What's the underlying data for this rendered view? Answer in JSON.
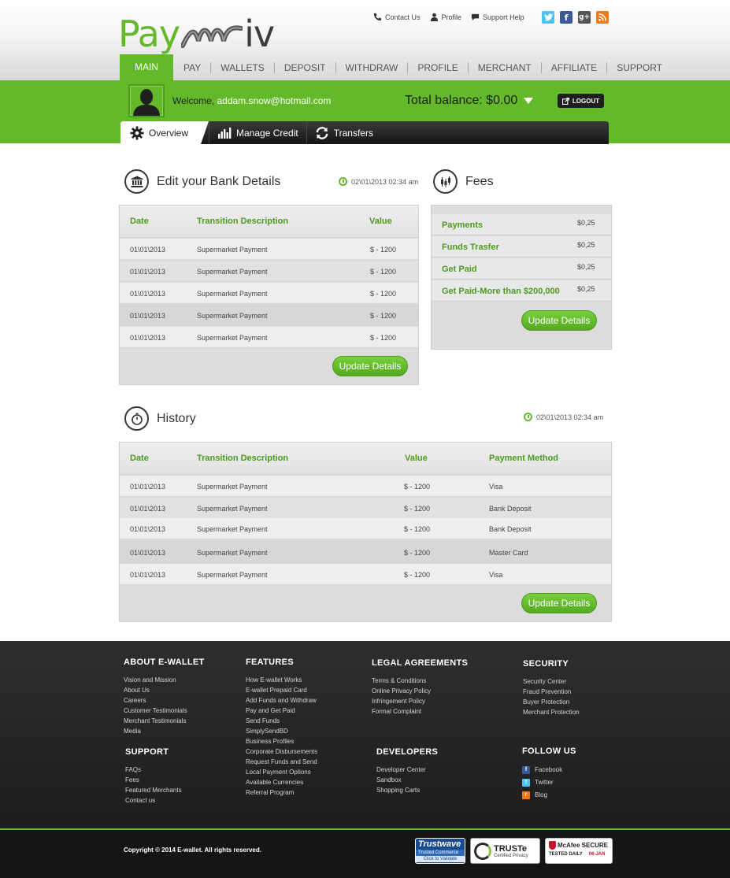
{
  "brand": {
    "logo_left": "Pay",
    "logo_right": "iv",
    "green": "#63b92a",
    "dark": "#1e1e1e"
  },
  "toplinks": [
    {
      "label": "Contact Us",
      "icon": "phone-icon"
    },
    {
      "label": "Profile",
      "icon": "user-icon"
    },
    {
      "label": "Support Help",
      "icon": "chat-bubble-icon"
    }
  ],
  "social_header": [
    {
      "name": "twitter",
      "glyph": "t",
      "color": "#4fc3ee"
    },
    {
      "name": "facebook",
      "glyph": "f",
      "color": "#3b5998"
    },
    {
      "name": "google-plus",
      "glyph": "g+",
      "color": "#555555"
    },
    {
      "name": "rss",
      "glyph": "r",
      "color": "#f07a1a"
    }
  ],
  "nav": [
    "MAIN",
    "PAY",
    "WALLETS",
    "DEPOSIT",
    "WITHDRAW",
    "PROFILE",
    "MERCHANT",
    "AFFILIATE",
    "SUPPORT"
  ],
  "user": {
    "welcome_label": "Welcome,",
    "email": "addam.snow@hotmail.com",
    "balance_label": "Total balance: $0.00",
    "logout_label": "LOGOUT"
  },
  "subtabs": [
    {
      "label": "Overview",
      "icon": "gear-icon"
    },
    {
      "label": "Manage Credit",
      "icon": "bar-chart-icon"
    },
    {
      "label": "Transfers",
      "icon": "refresh-icon"
    }
  ],
  "bank": {
    "title": "Edit your Bank Details",
    "timestamp": "02\\01\\2013 02:34 am",
    "headers": [
      "Date",
      "Transition Description",
      "Value"
    ],
    "rows": [
      [
        "01\\01\\2013",
        "Supermarket Payment",
        "$ - 1200"
      ],
      [
        "01\\01\\2013",
        "Supermarket Payment",
        "$ - 1200"
      ],
      [
        "01\\01\\2013",
        "Supermarket Payment",
        "$ - 1200"
      ],
      [
        "01\\01\\2013",
        "Supermarket Payment",
        "$ - 1200"
      ],
      [
        "01\\01\\2013",
        "Supermarket Payment",
        "$ - 1200"
      ]
    ],
    "button": "Update Details"
  },
  "fees": {
    "title": "Fees",
    "rows": [
      {
        "label": "Payments",
        "value": "$0,25"
      },
      {
        "label": "Funds Trasfer",
        "value": "$0,25"
      },
      {
        "label": "Get Paid",
        "value": "$0,25"
      },
      {
        "label": "Get Paid-More than $200,000",
        "value": "$0,25"
      }
    ],
    "button": "Update Details"
  },
  "history": {
    "title": "History",
    "timestamp": "02\\01\\2013 02:34 am",
    "headers": [
      "Date",
      "Transition Description",
      "Value",
      "Payment Method"
    ],
    "rows": [
      [
        "01\\01\\2013",
        "Supermarket Payment",
        "$ - 1200",
        "Visa"
      ],
      [
        "01\\01\\2013",
        "Supermarket Payment",
        "$ - 1200",
        "Bank Deposit"
      ],
      [
        "01\\01\\2013",
        "Supermarket Payment",
        "$ - 1200",
        "Bank Deposit"
      ],
      [
        "01\\01\\2013",
        "Supermarket Payment",
        "$ - 1200",
        "Master Card"
      ],
      [
        "01\\01\\2013",
        "Supermarket Payment",
        "$ - 1200",
        "Visa"
      ]
    ],
    "button": "Update Details"
  },
  "footer": {
    "about": {
      "title": "ABOUT E-WALLET",
      "links": [
        "Vision and Mission",
        "About Us",
        "Careers",
        "Customer Testimonials",
        "Merchant Testimonials",
        "Media"
      ]
    },
    "support": {
      "title": "SUPPORT",
      "links": [
        "FAQs",
        "Fees",
        "Featured Merchants",
        "Contact us"
      ]
    },
    "features": {
      "title": "FEATURES",
      "links": [
        "How E-wallet Works",
        "E-wallet Prepaid Card",
        "Add Funds and Withdraw",
        "Pay and Get Paid",
        "Send Funds",
        "SimplySendBD",
        "Business Profiles",
        "Corporate Disbursements",
        "Request Funds and Send",
        "Local Payment Options",
        "Available Currencies",
        "Referral Program"
      ]
    },
    "legal": {
      "title": "LEGAL AGREEMENTS",
      "links": [
        "Terms & Conditions",
        "Online Privacy Policy",
        "Infringement Policy",
        "Formal Complaint"
      ]
    },
    "developers": {
      "title": "DEVELOPERS",
      "links": [
        "Developer Center",
        "Sandbox",
        "Shopping Carts"
      ]
    },
    "security": {
      "title": "SECURITY",
      "links": [
        "Security Center",
        "Fraud Prevention",
        "Buyer Protection",
        "Merchant Protection"
      ]
    },
    "follow": {
      "title": "FOLLOW US",
      "links": [
        {
          "label": "Facebook",
          "glyph": "f",
          "color": "#3b5998"
        },
        {
          "label": "Twitter",
          "glyph": "t",
          "color": "#4fc3ee"
        },
        {
          "label": "Blog",
          "glyph": "r",
          "color": "#f07a1a"
        }
      ]
    },
    "copyright": "Copyright © 2014 E-wallet. All rights reserved.",
    "badges": {
      "trustwave_1": "Trustwave",
      "trustwave_2": "Trusted Commerce",
      "trustwave_3": "Click to Validate",
      "truste_1": "TRUSTe",
      "truste_2": "Certified Privacy",
      "mcafee_1": "McAfee SECURE",
      "mcafee_2": "TESTED DAILY",
      "mcafee_3": "06-JAN"
    }
  }
}
